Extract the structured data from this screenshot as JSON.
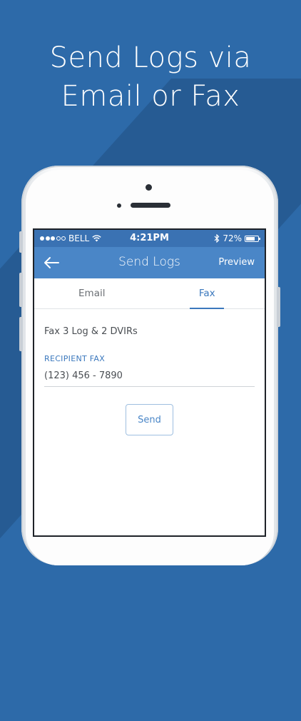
{
  "headline": {
    "line1": "Send Logs via",
    "line2": "Email or Fax"
  },
  "status_bar": {
    "signal_dots_filled": 3,
    "signal_dots_total": 5,
    "carrier": "BELL",
    "time": "4:21PM",
    "battery_text": "72%",
    "battery_level": 0.72
  },
  "nav": {
    "back_icon": "arrow-left-icon",
    "title": "Send Logs",
    "preview_label": "Preview"
  },
  "tabs": [
    {
      "label": "Email",
      "active": false
    },
    {
      "label": "Fax",
      "active": true
    }
  ],
  "form": {
    "summary": "Fax 3 Log & 2 DVIRs",
    "recipient_label": "RECIPIENT FAX",
    "recipient_value": "(123) 456 - 7890",
    "send_label": "Send"
  },
  "colors": {
    "background": "#2d6aa9",
    "status_bar": "#3a72b3",
    "nav_bar": "#4a86c7",
    "accent": "#3b78bd"
  }
}
